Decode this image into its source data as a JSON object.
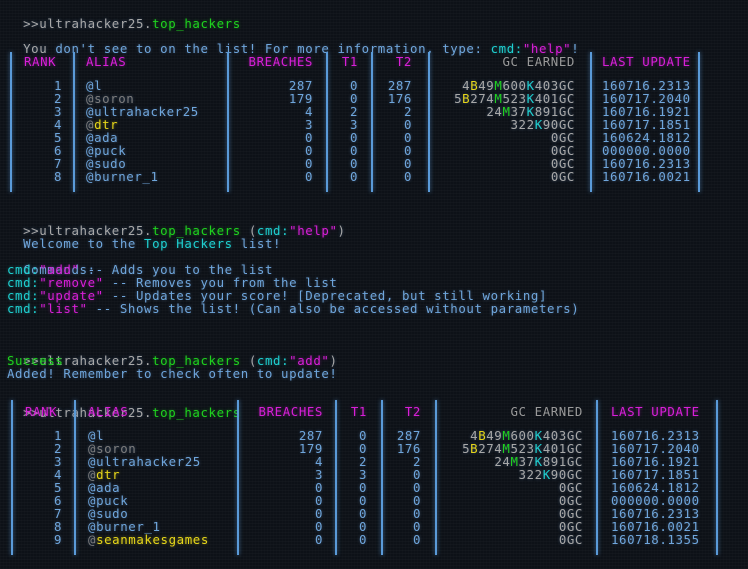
{
  "prompt": {
    "symbol": ">>",
    "user": "ultrahacker25",
    "dot": ".",
    "script": "top_hackers"
  },
  "block1": {
    "message_prefix": "You",
    "message": " don't see to on the list! For more information, type: ",
    "cmd_key": "cmd:",
    "cmd_value": "\"help\"",
    "suffix": "!"
  },
  "table_headers": {
    "rank": "RANK",
    "alias": "ALIAS",
    "breaches": "BREACHES",
    "t1": "T1",
    "t2": "T2",
    "gc_earned": "GC EARNED",
    "last_update": "LAST UPDATE"
  },
  "table1": {
    "rows": [
      {
        "rank": "1",
        "at": "@",
        "name": "l",
        "name_color": "blue",
        "at_color": "blue",
        "breaches": "287",
        "t1": "0",
        "t2": "287",
        "gc": [
          [
            "4",
            ""
          ],
          [
            "B",
            "B"
          ],
          [
            "49",
            ""
          ],
          [
            "M",
            "M"
          ],
          [
            "600",
            ""
          ],
          [
            "K",
            "K"
          ],
          [
            "403GC",
            ""
          ]
        ],
        "last_update": "160716.2313"
      },
      {
        "rank": "2",
        "at": "@",
        "name": "soron",
        "name_color": "dim",
        "at_color": "dim",
        "breaches": "179",
        "t1": "0",
        "t2": "176",
        "gc": [
          [
            "5",
            ""
          ],
          [
            "B",
            "B"
          ],
          [
            "274",
            ""
          ],
          [
            "M",
            "M"
          ],
          [
            "523",
            ""
          ],
          [
            "K",
            "K"
          ],
          [
            "401GC",
            ""
          ]
        ],
        "last_update": "160717.2040"
      },
      {
        "rank": "3",
        "at": "@",
        "name": "ultrahacker25",
        "name_color": "blue",
        "at_color": "blue",
        "breaches": "4",
        "t1": "2",
        "t2": "2",
        "gc": [
          [
            "24",
            ""
          ],
          [
            "M",
            "M"
          ],
          [
            "37",
            ""
          ],
          [
            "K",
            "K"
          ],
          [
            "891GC",
            ""
          ]
        ],
        "last_update": "160716.1921"
      },
      {
        "rank": "4",
        "at": "@",
        "name": "dtr",
        "name_color": "yellow",
        "at_color": "dim",
        "breaches": "3",
        "t1": "3",
        "t2": "0",
        "gc": [
          [
            "322",
            ""
          ],
          [
            "K",
            "K"
          ],
          [
            "90GC",
            ""
          ]
        ],
        "last_update": "160717.1851"
      },
      {
        "rank": "5",
        "at": "@",
        "name": "ada",
        "name_color": "blue",
        "at_color": "blue",
        "breaches": "0",
        "t1": "0",
        "t2": "0",
        "gc": [
          [
            "0GC",
            ""
          ]
        ],
        "last_update": "160624.1812"
      },
      {
        "rank": "6",
        "at": "@",
        "name": "puck",
        "name_color": "blue",
        "at_color": "blue",
        "breaches": "0",
        "t1": "0",
        "t2": "0",
        "gc": [
          [
            "0GC",
            ""
          ]
        ],
        "last_update": "000000.0000"
      },
      {
        "rank": "7",
        "at": "@",
        "name": "sudo",
        "name_color": "blue",
        "at_color": "blue",
        "breaches": "0",
        "t1": "0",
        "t2": "0",
        "gc": [
          [
            "0GC",
            ""
          ]
        ],
        "last_update": "160716.2313"
      },
      {
        "rank": "8",
        "at": "@",
        "name": "burner_1",
        "name_color": "blue",
        "at_color": "blue",
        "breaches": "0",
        "t1": "0",
        "t2": "0",
        "gc": [
          [
            "0GC",
            ""
          ]
        ],
        "last_update": "160716.0021"
      }
    ]
  },
  "block2": {
    "command_open": " (",
    "cmd_key": "cmd:",
    "cmd_value": "\"help\"",
    "command_close": ")",
    "welcome_prefix": "Welcome to the ",
    "welcome_highlight": "Top Hackers",
    "welcome_suffix": " list!",
    "commands_label": "Commands:",
    "commands": [
      {
        "key": "cmd:",
        "value": "\"add\"",
        "desc": " -- Adds you to the list"
      },
      {
        "key": "cmd:",
        "value": "\"remove\"",
        "desc": " -- Removes you from the list"
      },
      {
        "key": "cmd:",
        "value": "\"update\"",
        "desc": " -- Updates your score! [Deprecated, but still working]"
      },
      {
        "key": "cmd:",
        "value": "\"list\"",
        "desc": " -- Shows the list! (Can also be accessed without parameters)"
      }
    ]
  },
  "block3": {
    "command_open": " (",
    "cmd_key": "cmd:",
    "cmd_value": "\"add\"",
    "command_close": ")",
    "status": "Success",
    "message": "Added! Remember to check often to update!"
  },
  "table2": {
    "rows": [
      {
        "rank": "1",
        "at": "@",
        "name": "l",
        "name_color": "blue",
        "at_color": "blue",
        "breaches": "287",
        "t1": "0",
        "t2": "287",
        "gc": [
          [
            "4",
            ""
          ],
          [
            "B",
            "B"
          ],
          [
            "49",
            ""
          ],
          [
            "M",
            "M"
          ],
          [
            "600",
            ""
          ],
          [
            "K",
            "K"
          ],
          [
            "403GC",
            ""
          ]
        ],
        "last_update": "160716.2313"
      },
      {
        "rank": "2",
        "at": "@",
        "name": "soron",
        "name_color": "dim",
        "at_color": "dim",
        "breaches": "179",
        "t1": "0",
        "t2": "176",
        "gc": [
          [
            "5",
            ""
          ],
          [
            "B",
            "B"
          ],
          [
            "274",
            ""
          ],
          [
            "M",
            "M"
          ],
          [
            "523",
            ""
          ],
          [
            "K",
            "K"
          ],
          [
            "401GC",
            ""
          ]
        ],
        "last_update": "160717.2040"
      },
      {
        "rank": "3",
        "at": "@",
        "name": "ultrahacker25",
        "name_color": "blue",
        "at_color": "blue",
        "breaches": "4",
        "t1": "2",
        "t2": "2",
        "gc": [
          [
            "24",
            ""
          ],
          [
            "M",
            "M"
          ],
          [
            "37",
            ""
          ],
          [
            "K",
            "K"
          ],
          [
            "891GC",
            ""
          ]
        ],
        "last_update": "160716.1921"
      },
      {
        "rank": "4",
        "at": "@",
        "name": "dtr",
        "name_color": "yellow",
        "at_color": "dim",
        "breaches": "3",
        "t1": "3",
        "t2": "0",
        "gc": [
          [
            "322",
            ""
          ],
          [
            "K",
            "K"
          ],
          [
            "90GC",
            ""
          ]
        ],
        "last_update": "160717.1851"
      },
      {
        "rank": "5",
        "at": "@",
        "name": "ada",
        "name_color": "blue",
        "at_color": "blue",
        "breaches": "0",
        "t1": "0",
        "t2": "0",
        "gc": [
          [
            "0GC",
            ""
          ]
        ],
        "last_update": "160624.1812"
      },
      {
        "rank": "6",
        "at": "@",
        "name": "puck",
        "name_color": "blue",
        "at_color": "blue",
        "breaches": "0",
        "t1": "0",
        "t2": "0",
        "gc": [
          [
            "0GC",
            ""
          ]
        ],
        "last_update": "000000.0000"
      },
      {
        "rank": "7",
        "at": "@",
        "name": "sudo",
        "name_color": "blue",
        "at_color": "blue",
        "breaches": "0",
        "t1": "0",
        "t2": "0",
        "gc": [
          [
            "0GC",
            ""
          ]
        ],
        "last_update": "160716.2313"
      },
      {
        "rank": "8",
        "at": "@",
        "name": "burner_1",
        "name_color": "blue",
        "at_color": "blue",
        "breaches": "0",
        "t1": "0",
        "t2": "0",
        "gc": [
          [
            "0GC",
            ""
          ]
        ],
        "last_update": "160716.0021"
      },
      {
        "rank": "9",
        "at": "@",
        "name": "seanmakesgames",
        "name_color": "yellow",
        "at_color": "dim",
        "breaches": "0",
        "t1": "0",
        "t2": "0",
        "gc": [
          [
            "0GC",
            ""
          ]
        ],
        "last_update": "160718.1355"
      }
    ]
  }
}
